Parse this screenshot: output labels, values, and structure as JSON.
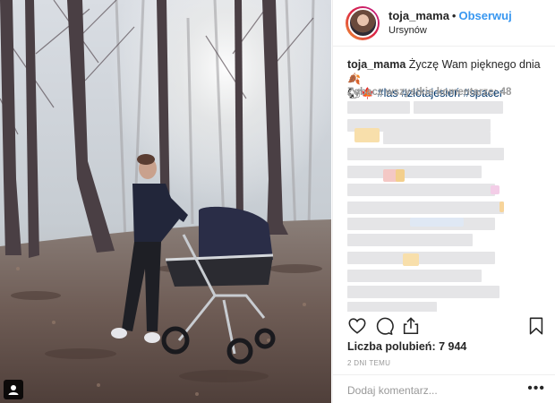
{
  "post": {
    "username": "toja_mama",
    "separator": "•",
    "follow_label": "Obserwuj",
    "location": "Ursynów",
    "caption_text": "Życzę Wam pięknego dnia",
    "caption_emoji_1": "🍂",
    "caption_emoji_2": "🐿",
    "caption_emoji_3": "🍁",
    "hashtag_1": "#las",
    "hashtag_2": "#złotajesień",
    "hashtag_3": "#spacer",
    "view_all_comments": "Zobacz wszystkie komentarze: 48",
    "likes_label": "Liczba polubień:",
    "likes_count": "7 944",
    "timestamp": "2 DNI TEMU",
    "comment_placeholder": "Dodaj komentarz...",
    "more_options": "•••"
  },
  "icons": {
    "like": "heart-icon",
    "comment": "comment-icon",
    "share": "share-icon",
    "save": "bookmark-icon",
    "corner": "user-tag-icon"
  },
  "colors": {
    "follow": "#3897f0",
    "hashtag": "#003569",
    "muted": "#999999",
    "text": "#262626",
    "blur_gray": "#e5e5e7"
  }
}
